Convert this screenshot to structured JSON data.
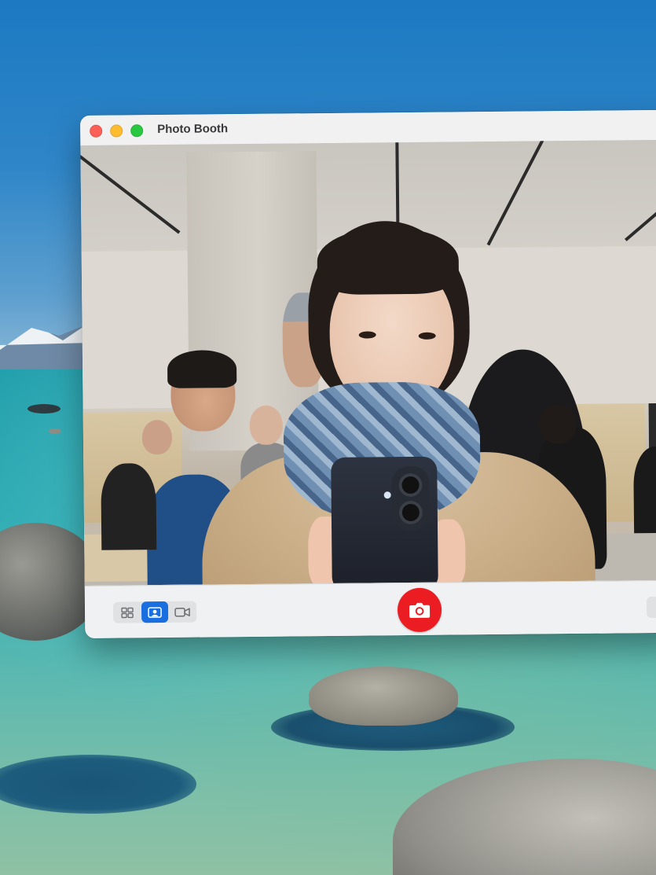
{
  "window": {
    "title": "Photo Booth"
  },
  "toolbar": {
    "modes": [
      {
        "icon": "grid-icon",
        "selected": false
      },
      {
        "icon": "single-photo-icon",
        "selected": true
      },
      {
        "icon": "video-icon",
        "selected": false
      }
    ],
    "shutter_icon": "camera-icon",
    "accent_color": "#ec1c23",
    "selected_mode_color": "#1a6fe0"
  }
}
